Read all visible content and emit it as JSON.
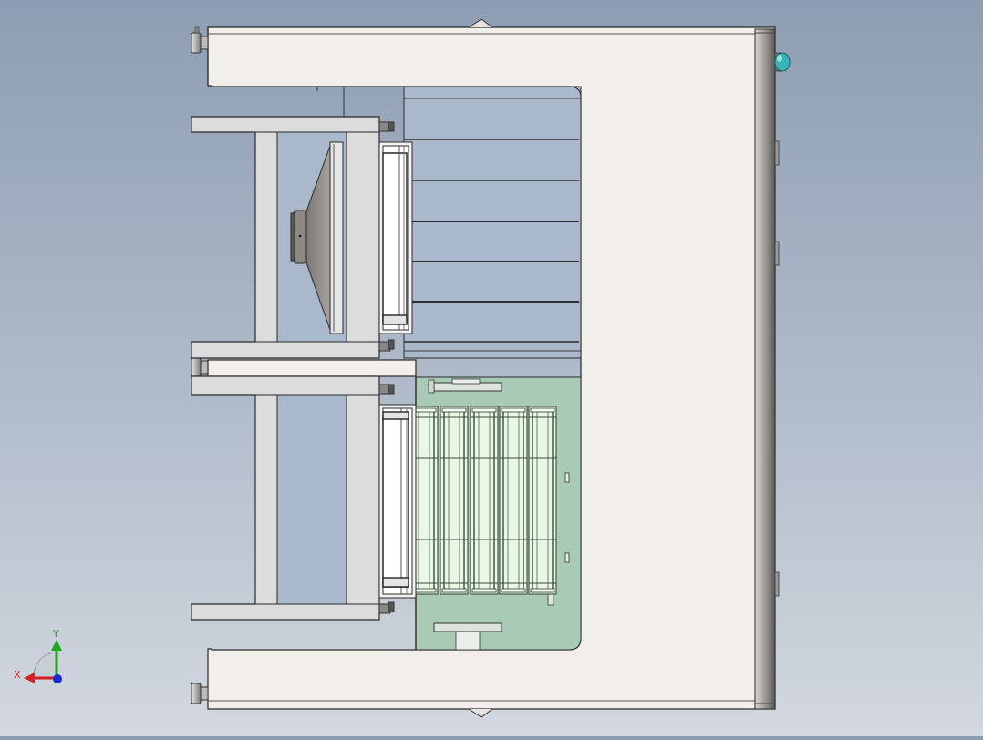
{
  "view": {
    "triad": {
      "x_label": "X",
      "y_label": "Y",
      "x_color": "#d42020",
      "y_color": "#1fa81f",
      "z_color": "#1a2ad0"
    }
  },
  "colors": {
    "frame_fill": "#f2eeea",
    "frame_stroke": "#2a2a2a",
    "stand_fill": "#dcdcdc",
    "upper_panel": "#aab8cc",
    "glass_panel": "#a9cbb5",
    "tray_fill": "#e8f8e4",
    "indicator": "#39b2b8"
  }
}
